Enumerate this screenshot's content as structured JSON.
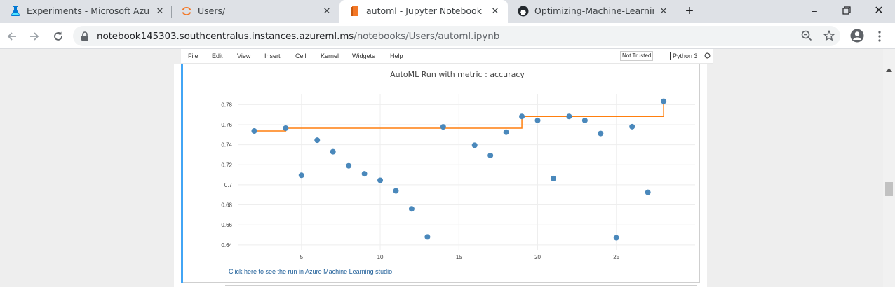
{
  "tabs": [
    {
      "title": "Experiments - Microsoft Azure M",
      "icon": "azure-ml-flask-icon"
    },
    {
      "title": "Users/",
      "icon": "jupyter-icon"
    },
    {
      "title": "automl - Jupyter Notebook",
      "icon": "notebook-icon"
    },
    {
      "title": "Optimizing-Machine-Learning-Pi",
      "icon": "github-icon"
    }
  ],
  "address": {
    "host": "notebook145303.southcentralus.instances.azureml.ms",
    "path": "/notebooks/Users/automl.ipynb"
  },
  "menubar": {
    "items": [
      "File",
      "Edit",
      "View",
      "Insert",
      "Cell",
      "Kernel",
      "Widgets",
      "Help"
    ],
    "trust": "Not Trusted",
    "kernel": "Python 3"
  },
  "link_text": "Click here to see the run in Azure Machine Learning studio",
  "colors": {
    "scatter": "#4a88bb",
    "step": "#ff7f0e",
    "cell_bar": "#42a5f5",
    "link": "#1f5f99"
  },
  "chart_data": {
    "type": "scatter",
    "title": "AutoML Run with metric : accuracy",
    "xlabel": "",
    "ylabel": "",
    "xlim": [
      1,
      30
    ],
    "ylim": [
      0.635,
      0.79
    ],
    "xticks": [
      5,
      10,
      15,
      20,
      25
    ],
    "yticks": [
      0.64,
      0.66,
      0.68,
      0.7,
      0.72,
      0.74,
      0.76,
      0.78
    ],
    "ytick_labels": [
      "0.64",
      "0.66",
      "0.68",
      "0.7",
      "0.72",
      "0.74",
      "0.76",
      "0.78"
    ],
    "grid": true,
    "series": [
      {
        "type": "scatter",
        "x": [
          2,
          4,
          5,
          6,
          7,
          8,
          9,
          10,
          11,
          12,
          13,
          14,
          16,
          17,
          18,
          19,
          20,
          21,
          22,
          23,
          24,
          25,
          26,
          27,
          28
        ],
        "y": [
          0.7537,
          0.7565,
          0.7095,
          0.7445,
          0.733,
          0.719,
          0.711,
          0.7045,
          0.694,
          0.676,
          0.648,
          0.7578,
          0.7395,
          0.7293,
          0.7525,
          0.7682,
          0.7642,
          0.7063,
          0.7682,
          0.7642,
          0.7512,
          0.6472,
          0.758,
          0.6925,
          0.7833
        ]
      },
      {
        "type": "step",
        "x": [
          2,
          4,
          19,
          28
        ],
        "y": [
          0.7537,
          0.7565,
          0.7682,
          0.7833
        ]
      }
    ]
  }
}
